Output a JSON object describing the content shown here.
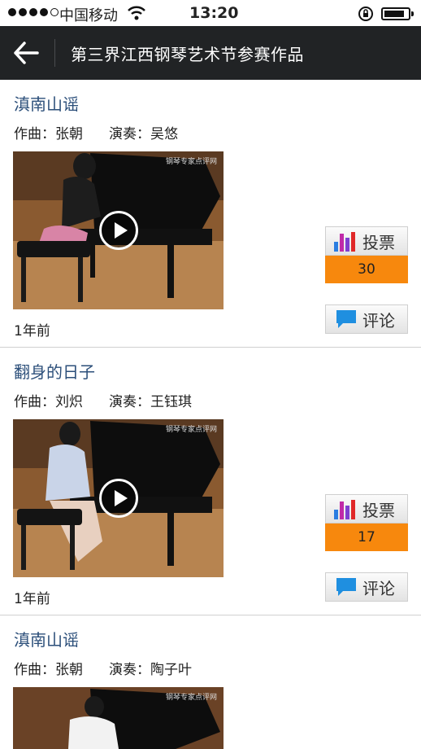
{
  "status_bar": {
    "carrier": "中国移动",
    "time": "13:20"
  },
  "header": {
    "title": "第三界江西钢琴艺术节参赛作品"
  },
  "items": [
    {
      "song": "滇南山谣",
      "composer": "作曲：张朝",
      "performer": "演奏：吴悠",
      "time_ago": "1年前",
      "vote_label": "投票",
      "votes": "30",
      "comment_label": "评论",
      "watermark": "钢琴专家点评网"
    },
    {
      "song": "翻身的日子",
      "composer": "作曲：刘炽",
      "performer": "演奏：王钰琪",
      "time_ago": "1年前",
      "vote_label": "投票",
      "votes": "17",
      "comment_label": "评论",
      "watermark": "钢琴专家点评网"
    },
    {
      "song": "滇南山谣",
      "composer": "作曲：张朝",
      "performer": "演奏：陶子叶",
      "watermark": "钢琴专家点评网"
    }
  ],
  "colors": {
    "nav_bg": "#212325",
    "title_link": "#2c4f7a",
    "vote_count_bg": "#f7880d"
  },
  "icons": [
    "back-arrow-icon",
    "bar-chart-icon",
    "speech-bubble-icon",
    "play-icon",
    "wifi-icon",
    "lock-rotation-icon",
    "battery-icon"
  ]
}
